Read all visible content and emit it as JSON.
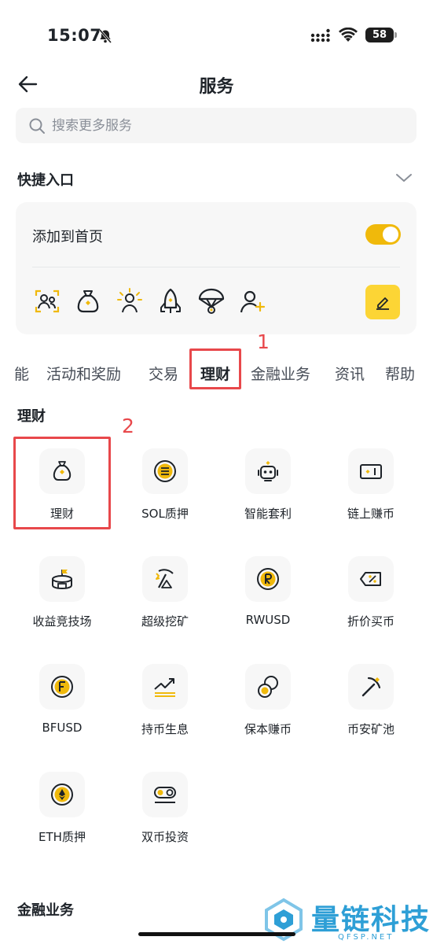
{
  "status_bar": {
    "time": "15:07",
    "battery": "58"
  },
  "header": {
    "title": "服务"
  },
  "search": {
    "placeholder": "搜索更多服务"
  },
  "quick_entry": {
    "title": "快捷入口",
    "add_to_home_label": "添加到首页",
    "toggle_on": true,
    "icons": [
      "profile-scan-icon",
      "money-bag-icon",
      "sun-person-icon",
      "rocket-icon",
      "parachute-icon",
      "add-user-icon"
    ]
  },
  "annotations": {
    "one": "1",
    "two": "2"
  },
  "tabs": [
    {
      "label": "能",
      "active": false
    },
    {
      "label": "活动和奖励",
      "active": false
    },
    {
      "label": "交易",
      "active": false
    },
    {
      "label": "理财",
      "active": true
    },
    {
      "label": "金融业务",
      "active": false
    },
    {
      "label": "资讯",
      "active": false
    },
    {
      "label": "帮助",
      "active": false
    }
  ],
  "sections": {
    "finance": {
      "title": "理财",
      "items": [
        {
          "label": "理财",
          "icon": "money-bag-icon"
        },
        {
          "label": "SOL质押",
          "icon": "sol-coin-icon"
        },
        {
          "label": "智能套利",
          "icon": "robot-icon"
        },
        {
          "label": "链上赚币",
          "icon": "onchain-wallet-icon"
        },
        {
          "label": "收益竞技场",
          "icon": "arena-flag-icon"
        },
        {
          "label": "超级挖矿",
          "icon": "mining-pickaxe-icon"
        },
        {
          "label": "RWUSD",
          "icon": "rwusd-coin-icon"
        },
        {
          "label": "折价买币",
          "icon": "discount-tag-icon"
        },
        {
          "label": "BFUSD",
          "icon": "bfusd-coin-icon"
        },
        {
          "label": "持币生息",
          "icon": "trend-up-icon"
        },
        {
          "label": "保本赚币",
          "icon": "coins-icon"
        },
        {
          "label": "币安矿池",
          "icon": "pickaxe-icon"
        },
        {
          "label": "ETH质押",
          "icon": "eth-coin-icon"
        },
        {
          "label": "双币投资",
          "icon": "dual-coin-icon"
        }
      ]
    },
    "financial_business": {
      "title": "金融业务"
    }
  },
  "watermark": {
    "text": "量链科技",
    "sub": "QFSP.NET"
  },
  "colors": {
    "accent": "#f0b90b",
    "accent_light": "#fcd535",
    "annotation": "#e8484b",
    "text": "#1e2329"
  }
}
